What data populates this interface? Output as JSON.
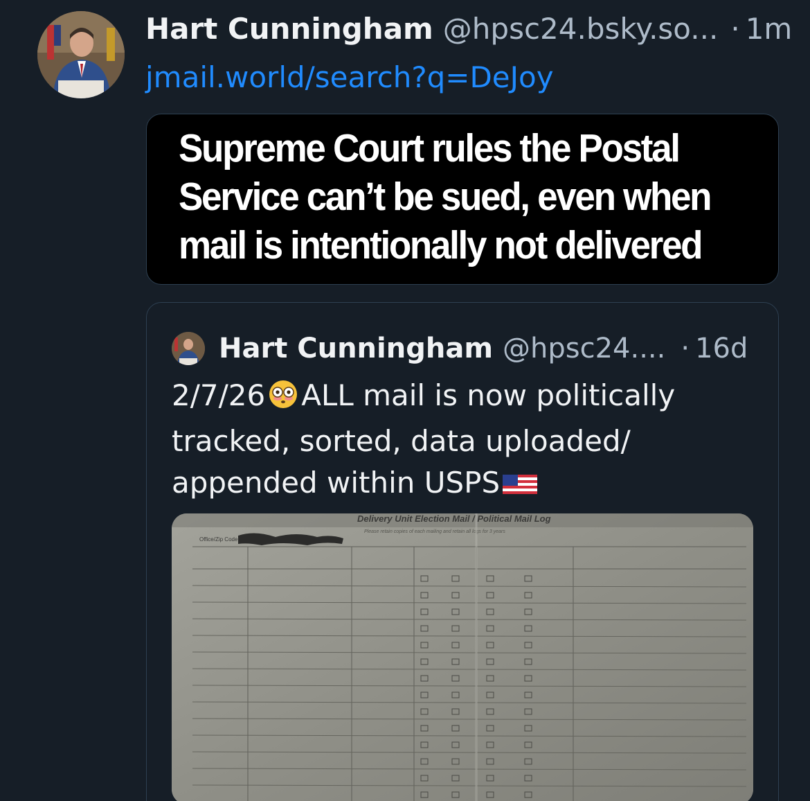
{
  "post": {
    "author": {
      "display_name": "Hart Cunningham",
      "handle": "@hpsc24.bsky.so...",
      "avatar_icon": "avatar-photo"
    },
    "separator": "·",
    "time": "1m",
    "link_text": "jmail.world/search?q=DeJoy",
    "embed_headline": "Supreme Court rules the Postal Service can’t be sued, even when mail is intentionally not delivered"
  },
  "quote": {
    "author": {
      "display_name": "Hart Cunningham",
      "handle": "@hpsc24....",
      "avatar_icon": "avatar-photo"
    },
    "separator": "·",
    "time": "16d",
    "text_date": "2/7/26",
    "text_body": "ALL mail is now politically tracked, sorted, data uploaded/ appended within USPS",
    "emoji_start": "flushed-face-emoji",
    "emoji_end": "us-flag-emoji",
    "image": {
      "form_title": "Delivery Unit Election Mail / Political Mail Log",
      "form_subtitle": "Please retain copies of each mailing and retain all logs for 3 years",
      "office_label": "Office/Zip Code"
    }
  },
  "colors": {
    "background": "#161e27",
    "link": "#208bfe",
    "muted": "#aebbc9",
    "border": "#2e4052"
  }
}
